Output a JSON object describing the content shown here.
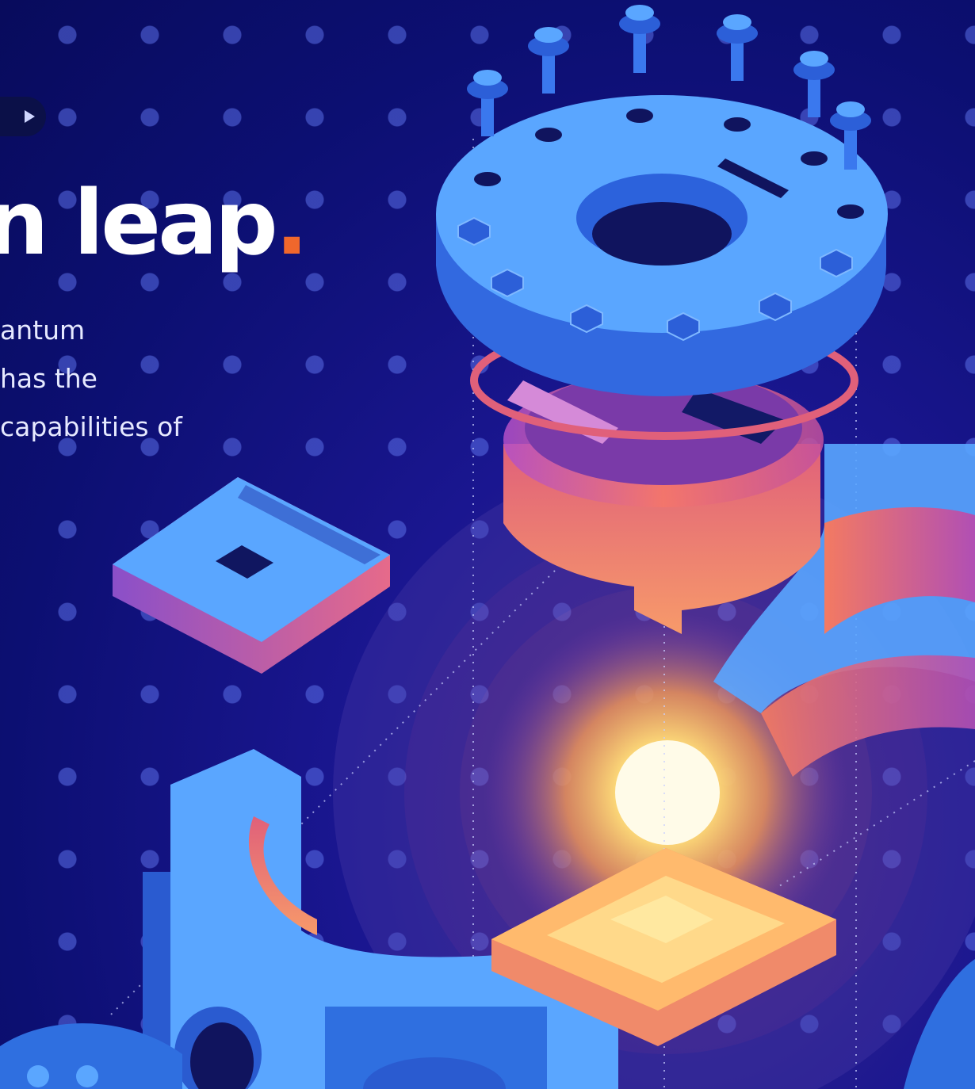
{
  "hero": {
    "play_icon": "play-icon",
    "headline": "n leap",
    "headline_punct": ".",
    "body_lines": [
      "antum",
      "has the",
      "capabilities of"
    ]
  },
  "colors": {
    "background": "#0c0f72",
    "accent_orange": "#f0672c",
    "plate_blue": "#5aa6ff",
    "glow_yellow": "#fff3b0"
  },
  "illustration": {
    "name": "quantum-chip-assembly-illustration"
  }
}
